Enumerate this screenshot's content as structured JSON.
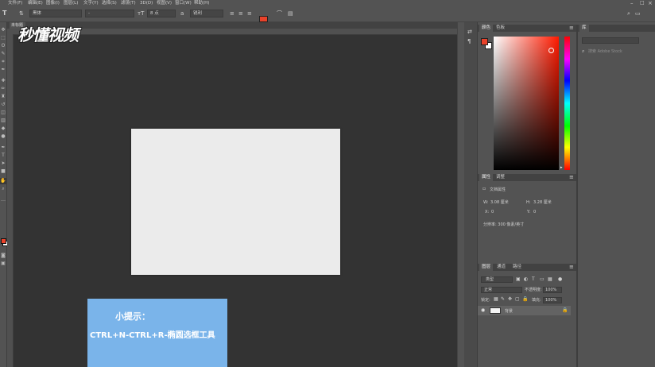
{
  "menu": [
    "文件(F)",
    "编辑(E)",
    "图像(I)",
    "图层(L)",
    "文字(Y)",
    "选择(S)",
    "滤镜(T)",
    "3D(D)",
    "视图(V)",
    "窗口(W)",
    "帮助(H)"
  ],
  "options_bar": {
    "tool_glyph": "T",
    "font_family": "黑体",
    "font_style": "-",
    "font_size": "8 点",
    "antialias": "锐利",
    "text_color": "#e8422a"
  },
  "document": {
    "tab_label": "未标题",
    "canvas_color": "#ebebeb"
  },
  "watermark": {
    "logo_text": "秒懂视频"
  },
  "tip": {
    "title": "小提示：",
    "body": "CTRL+N-CTRL+R-椭圆选框工具"
  },
  "color_panel": {
    "tabs": [
      "颜色",
      "色板"
    ],
    "foreground": "#e8422a",
    "background": "#ffffff"
  },
  "properties_panel": {
    "tabs": [
      "属性",
      "调整"
    ],
    "title": "文档属性",
    "w_label": "W:",
    "w_value": "3.08 厘米",
    "h_label": "H:",
    "h_value": "3.28 厘米",
    "x_label": "X:",
    "x_value": "0",
    "y_label": "Y:",
    "y_value": "0",
    "resolution": "分辨率: 300 像素/英寸"
  },
  "layers_panel": {
    "tabs": [
      "图层",
      "通道",
      "路径"
    ],
    "filter_placeholder": "类型",
    "blend_mode": "正常",
    "opacity_label": "不透明度:",
    "opacity_value": "100%",
    "lock_label": "锁定:",
    "fill_label": "填充:",
    "fill_value": "100%",
    "layer_name": "背景"
  },
  "library_panel": {
    "tab": "库",
    "search_placeholder": "搜索 Adobe Stock"
  }
}
